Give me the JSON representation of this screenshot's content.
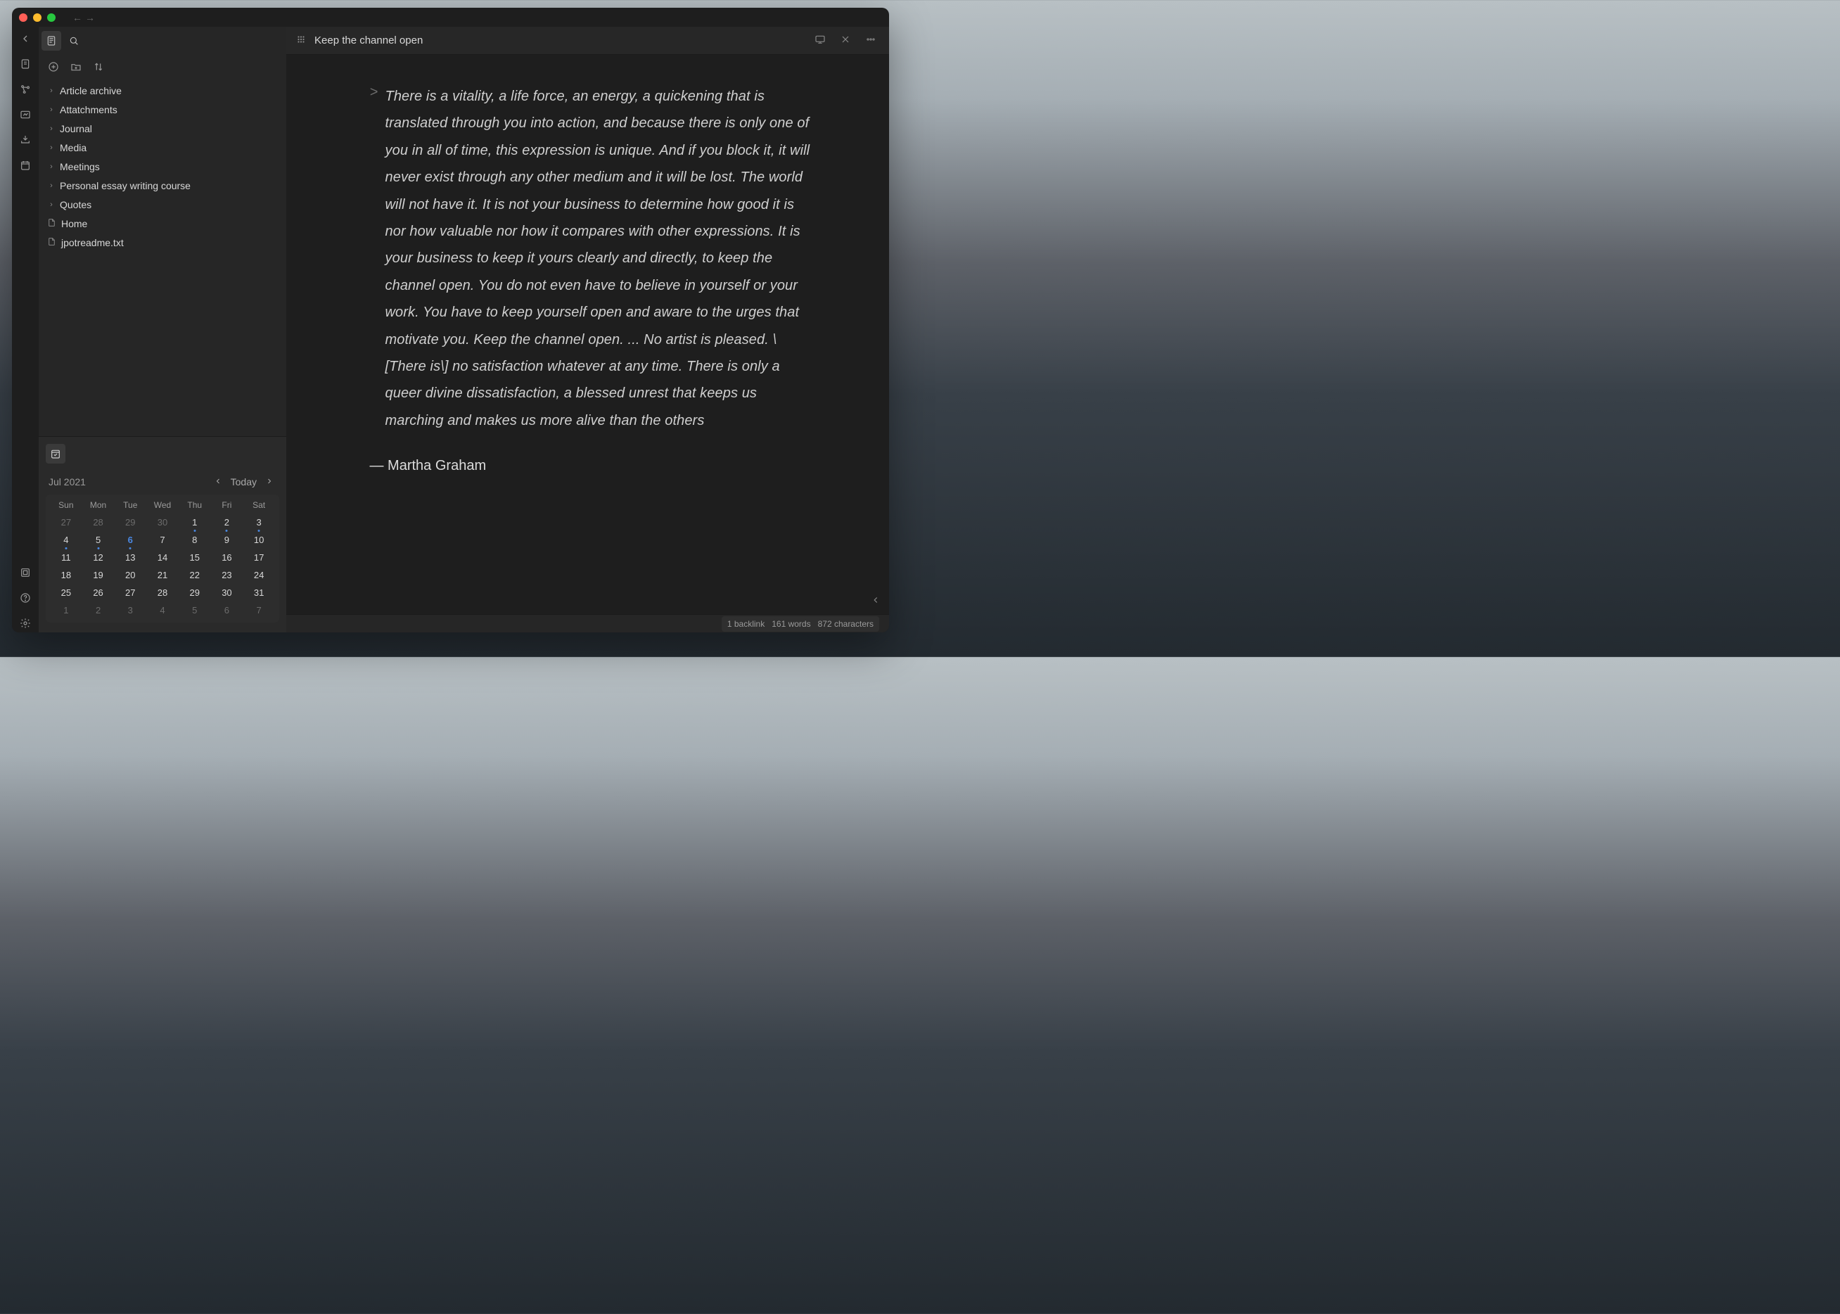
{
  "tab_title": "Keep the channel open",
  "sidebar": {
    "items": [
      {
        "label": "Article archive",
        "type": "folder"
      },
      {
        "label": "Attatchments",
        "type": "folder"
      },
      {
        "label": "Journal",
        "type": "folder"
      },
      {
        "label": "Media",
        "type": "folder"
      },
      {
        "label": "Meetings",
        "type": "folder"
      },
      {
        "label": "Personal essay writing course",
        "type": "folder"
      },
      {
        "label": "Quotes",
        "type": "folder"
      },
      {
        "label": "Home",
        "type": "file"
      },
      {
        "label": "jpotreadme.txt",
        "type": "file"
      }
    ]
  },
  "calendar": {
    "title": "Jul 2021",
    "today_label": "Today",
    "dow": [
      "Sun",
      "Mon",
      "Tue",
      "Wed",
      "Thu",
      "Fri",
      "Sat"
    ],
    "days": [
      {
        "n": "27",
        "dim": true
      },
      {
        "n": "28",
        "dim": true
      },
      {
        "n": "29",
        "dim": true
      },
      {
        "n": "30",
        "dim": true
      },
      {
        "n": "1",
        "dot": true
      },
      {
        "n": "2",
        "dot": true
      },
      {
        "n": "3",
        "dot": true
      },
      {
        "n": "4",
        "dot": true
      },
      {
        "n": "5",
        "dot": true
      },
      {
        "n": "6",
        "dot": true,
        "sel": true
      },
      {
        "n": "7"
      },
      {
        "n": "8"
      },
      {
        "n": "9"
      },
      {
        "n": "10"
      },
      {
        "n": "11"
      },
      {
        "n": "12"
      },
      {
        "n": "13"
      },
      {
        "n": "14"
      },
      {
        "n": "15"
      },
      {
        "n": "16"
      },
      {
        "n": "17"
      },
      {
        "n": "18"
      },
      {
        "n": "19"
      },
      {
        "n": "20"
      },
      {
        "n": "21"
      },
      {
        "n": "22"
      },
      {
        "n": "23"
      },
      {
        "n": "24"
      },
      {
        "n": "25"
      },
      {
        "n": "26"
      },
      {
        "n": "27"
      },
      {
        "n": "28"
      },
      {
        "n": "29"
      },
      {
        "n": "30"
      },
      {
        "n": "31"
      },
      {
        "n": "1",
        "dim": true
      },
      {
        "n": "2",
        "dim": true
      },
      {
        "n": "3",
        "dim": true
      },
      {
        "n": "4",
        "dim": true
      },
      {
        "n": "5",
        "dim": true
      },
      {
        "n": "6",
        "dim": true
      },
      {
        "n": "7",
        "dim": true
      }
    ]
  },
  "note": {
    "quote": "There is a vitality, a life force, an energy, a quickening that is translated through you into action, and because there is only one of you in all of time, this expression is unique. And if you block it, it will never exist through any other medium and it will be lost. The world will not have it. It is not your business to determine how good it is nor how valuable nor how it compares with other expressions. It is your business to keep it yours clearly and directly, to keep the channel open. You do not even have to believe in yourself or your work. You have to keep yourself open and aware to the urges that motivate you. Keep the channel open. ... No artist is pleased. \\[There is\\] no satisfaction whatever at any time. There is only a queer divine dissatisfaction, a blessed unrest that keeps us marching and makes us more alive than the others",
    "attribution": "— Martha Graham"
  },
  "status": {
    "backlinks": "1 backlink",
    "words": "161 words",
    "chars": "872 characters"
  }
}
